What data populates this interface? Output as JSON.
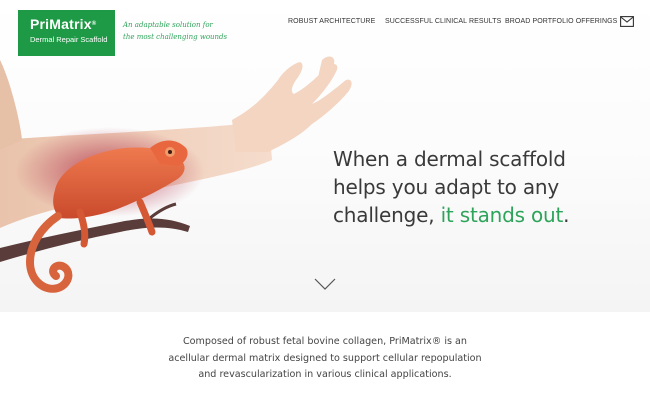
{
  "brand": {
    "name": "PriMatrix",
    "trademark": "®",
    "subtitle": "Dermal Repair Scaffold",
    "tagline_lines": [
      "An adaptable solution for",
      "the most challenging wounds"
    ]
  },
  "nav": {
    "items": [
      {
        "label": "ROBUST ARCHITECTURE"
      },
      {
        "label": "SUCCESSFUL CLINICAL RESULTS"
      },
      {
        "label": "BROAD PORTFOLIO OFFERINGS"
      }
    ],
    "contact_icon": "envelope-icon"
  },
  "hero": {
    "headline_lines": [
      "When a dermal scaffold",
      "helps you adapt to any",
      "challenge,"
    ],
    "headline_highlight": "it stands out",
    "headline_end": ".",
    "image": "arm-with-chameleon-on-branch",
    "scroll_icon": "chevron-down-icon"
  },
  "intro": {
    "lines": [
      "Composed of robust fetal bovine collagen, PriMatrix® is an",
      "acellular dermal matrix designed to support cellular repopulation",
      "and revascularization in various clinical applications."
    ]
  },
  "colors": {
    "brand_green": "#1e9a46",
    "accent_green": "#2ea45a",
    "chameleon": "#e0613a"
  }
}
